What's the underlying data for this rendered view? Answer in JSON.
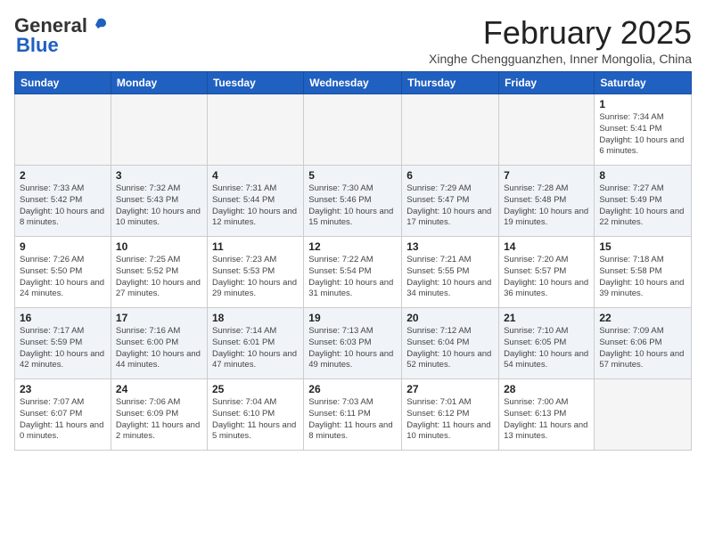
{
  "header": {
    "logo_general": "General",
    "logo_blue": "Blue",
    "month_title": "February 2025",
    "location": "Xinghe Chengguanzhen, Inner Mongolia, China"
  },
  "days_of_week": [
    "Sunday",
    "Monday",
    "Tuesday",
    "Wednesday",
    "Thursday",
    "Friday",
    "Saturday"
  ],
  "weeks": [
    {
      "shaded": false,
      "days": [
        {
          "number": "",
          "info": ""
        },
        {
          "number": "",
          "info": ""
        },
        {
          "number": "",
          "info": ""
        },
        {
          "number": "",
          "info": ""
        },
        {
          "number": "",
          "info": ""
        },
        {
          "number": "",
          "info": ""
        },
        {
          "number": "1",
          "info": "Sunrise: 7:34 AM\nSunset: 5:41 PM\nDaylight: 10 hours and 6 minutes."
        }
      ]
    },
    {
      "shaded": true,
      "days": [
        {
          "number": "2",
          "info": "Sunrise: 7:33 AM\nSunset: 5:42 PM\nDaylight: 10 hours and 8 minutes."
        },
        {
          "number": "3",
          "info": "Sunrise: 7:32 AM\nSunset: 5:43 PM\nDaylight: 10 hours and 10 minutes."
        },
        {
          "number": "4",
          "info": "Sunrise: 7:31 AM\nSunset: 5:44 PM\nDaylight: 10 hours and 12 minutes."
        },
        {
          "number": "5",
          "info": "Sunrise: 7:30 AM\nSunset: 5:46 PM\nDaylight: 10 hours and 15 minutes."
        },
        {
          "number": "6",
          "info": "Sunrise: 7:29 AM\nSunset: 5:47 PM\nDaylight: 10 hours and 17 minutes."
        },
        {
          "number": "7",
          "info": "Sunrise: 7:28 AM\nSunset: 5:48 PM\nDaylight: 10 hours and 19 minutes."
        },
        {
          "number": "8",
          "info": "Sunrise: 7:27 AM\nSunset: 5:49 PM\nDaylight: 10 hours and 22 minutes."
        }
      ]
    },
    {
      "shaded": false,
      "days": [
        {
          "number": "9",
          "info": "Sunrise: 7:26 AM\nSunset: 5:50 PM\nDaylight: 10 hours and 24 minutes."
        },
        {
          "number": "10",
          "info": "Sunrise: 7:25 AM\nSunset: 5:52 PM\nDaylight: 10 hours and 27 minutes."
        },
        {
          "number": "11",
          "info": "Sunrise: 7:23 AM\nSunset: 5:53 PM\nDaylight: 10 hours and 29 minutes."
        },
        {
          "number": "12",
          "info": "Sunrise: 7:22 AM\nSunset: 5:54 PM\nDaylight: 10 hours and 31 minutes."
        },
        {
          "number": "13",
          "info": "Sunrise: 7:21 AM\nSunset: 5:55 PM\nDaylight: 10 hours and 34 minutes."
        },
        {
          "number": "14",
          "info": "Sunrise: 7:20 AM\nSunset: 5:57 PM\nDaylight: 10 hours and 36 minutes."
        },
        {
          "number": "15",
          "info": "Sunrise: 7:18 AM\nSunset: 5:58 PM\nDaylight: 10 hours and 39 minutes."
        }
      ]
    },
    {
      "shaded": true,
      "days": [
        {
          "number": "16",
          "info": "Sunrise: 7:17 AM\nSunset: 5:59 PM\nDaylight: 10 hours and 42 minutes."
        },
        {
          "number": "17",
          "info": "Sunrise: 7:16 AM\nSunset: 6:00 PM\nDaylight: 10 hours and 44 minutes."
        },
        {
          "number": "18",
          "info": "Sunrise: 7:14 AM\nSunset: 6:01 PM\nDaylight: 10 hours and 47 minutes."
        },
        {
          "number": "19",
          "info": "Sunrise: 7:13 AM\nSunset: 6:03 PM\nDaylight: 10 hours and 49 minutes."
        },
        {
          "number": "20",
          "info": "Sunrise: 7:12 AM\nSunset: 6:04 PM\nDaylight: 10 hours and 52 minutes."
        },
        {
          "number": "21",
          "info": "Sunrise: 7:10 AM\nSunset: 6:05 PM\nDaylight: 10 hours and 54 minutes."
        },
        {
          "number": "22",
          "info": "Sunrise: 7:09 AM\nSunset: 6:06 PM\nDaylight: 10 hours and 57 minutes."
        }
      ]
    },
    {
      "shaded": false,
      "days": [
        {
          "number": "23",
          "info": "Sunrise: 7:07 AM\nSunset: 6:07 PM\nDaylight: 11 hours and 0 minutes."
        },
        {
          "number": "24",
          "info": "Sunrise: 7:06 AM\nSunset: 6:09 PM\nDaylight: 11 hours and 2 minutes."
        },
        {
          "number": "25",
          "info": "Sunrise: 7:04 AM\nSunset: 6:10 PM\nDaylight: 11 hours and 5 minutes."
        },
        {
          "number": "26",
          "info": "Sunrise: 7:03 AM\nSunset: 6:11 PM\nDaylight: 11 hours and 8 minutes."
        },
        {
          "number": "27",
          "info": "Sunrise: 7:01 AM\nSunset: 6:12 PM\nDaylight: 11 hours and 10 minutes."
        },
        {
          "number": "28",
          "info": "Sunrise: 7:00 AM\nSunset: 6:13 PM\nDaylight: 11 hours and 13 minutes."
        },
        {
          "number": "",
          "info": ""
        }
      ]
    }
  ]
}
